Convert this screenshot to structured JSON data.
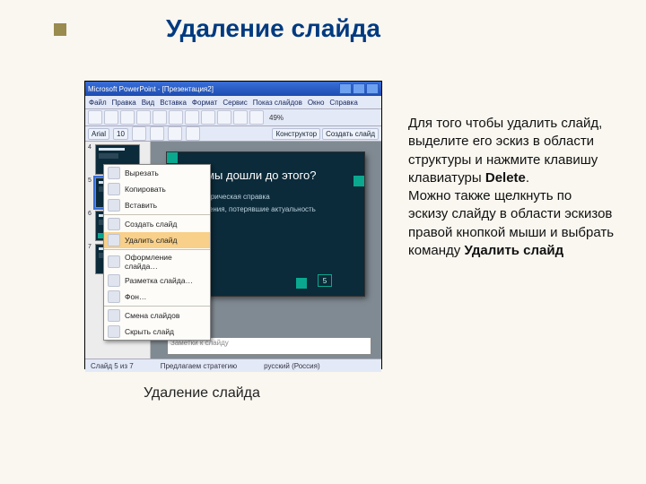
{
  "accent_color": "#9a8b4f",
  "title": "Удаление слайда",
  "body": {
    "p1a": "Для того чтобы удалить слайд, выделите его эскиз в области структуры и нажмите клавишу клавиатуры ",
    "p1_bold": "Delete",
    "p1b": ".",
    "p2a": "Можно также щелкнуть по эскизу слайду в области эскизов правой кнопкой мыши и выбрать команду ",
    "p2_bold": "Удалить слайд"
  },
  "caption": "Удаление слайда",
  "screenshot": {
    "app_title": "Microsoft PowerPoint - [Презентация2]",
    "menus": [
      "Файл",
      "Правка",
      "Вид",
      "Вставка",
      "Формат",
      "Сервис",
      "Показ слайдов",
      "Окно",
      "Справка"
    ],
    "zoom": "49%",
    "font_name": "Arial",
    "font_size": "10",
    "right_buttons": {
      "designer": "Конструктор",
      "new_slide": "Создать слайд"
    },
    "slide": {
      "title": "Как мы дошли до этого?",
      "bullets": [
        "Историческая справка",
        "Решения, потерявшие актуальность"
      ],
      "number": "5"
    },
    "thumbs": [
      "4",
      "5",
      "6",
      "7"
    ],
    "selected_thumb": "5",
    "context_menu": [
      "Вырезать",
      "Копировать",
      "Вставить",
      "Создать слайд",
      "Удалить слайд",
      "Оформление слайда…",
      "Разметка слайда…",
      "Фон…",
      "Смена слайдов",
      "Скрыть слайд"
    ],
    "context_highlight": "Удалить слайд",
    "notes_placeholder": "Заметки к слайду",
    "status": {
      "left": "Слайд 5 из 7",
      "center": "Предлагаем стратегию",
      "right": "русский (Россия)"
    }
  }
}
